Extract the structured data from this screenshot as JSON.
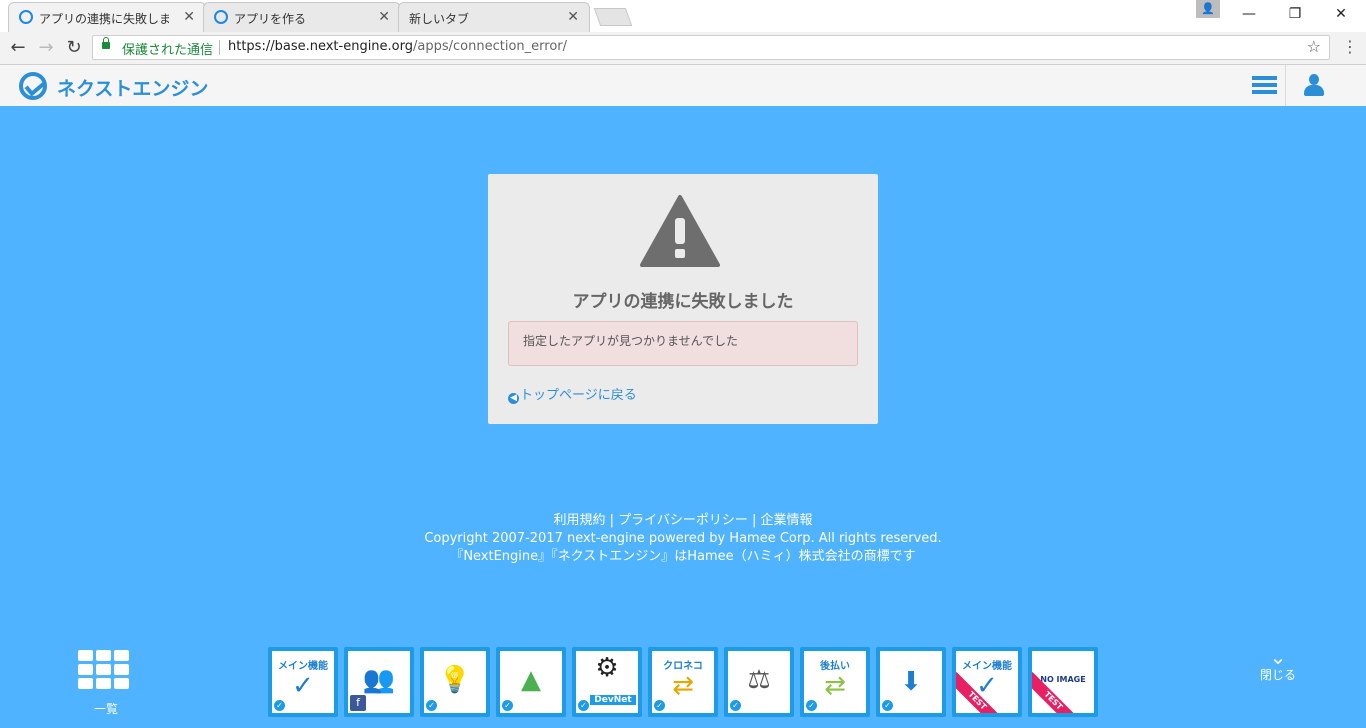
{
  "browser": {
    "tabs": [
      {
        "title": "アプリの連携に失敗しました",
        "active": true
      },
      {
        "title": "アプリを作る",
        "active": false
      },
      {
        "title": "新しいタブ",
        "active": false
      }
    ],
    "secure_label": "保護された通信",
    "url_host": "https://base.next-engine.org",
    "url_path": "/apps/connection_error/"
  },
  "app": {
    "logo_text": "ネクストエンジン"
  },
  "error": {
    "title": "アプリの連携に失敗しました",
    "message": "指定したアプリが見つかりませんでした",
    "back_link": "トップページに戻る"
  },
  "footer": {
    "links": [
      "利用規約",
      "プライバシーポリシー",
      "企業情報"
    ],
    "separator": "|",
    "copyright": "Copyright 2007-2017 next-engine powered by Hamee Corp. All rights reserved.",
    "trademark": "『NextEngine』『ネクストエンジン』はHamee（ハミィ）株式会社の商標です"
  },
  "dock": {
    "grid_label": "一覧",
    "close_label": "閉じる",
    "tiles": [
      {
        "label": "メイン機能",
        "glyph": "✓",
        "ribbon": ""
      },
      {
        "label": "",
        "glyph": "👥",
        "ribbon": ""
      },
      {
        "label": "",
        "glyph": "💡",
        "ribbon": ""
      },
      {
        "label": "",
        "glyph": "▲",
        "ribbon": ""
      },
      {
        "label": "DevNet",
        "glyph": "⚙",
        "ribbon": ""
      },
      {
        "label": "クロネコ",
        "glyph": "⇄",
        "ribbon": ""
      },
      {
        "label": "",
        "glyph": "⚖",
        "ribbon": ""
      },
      {
        "label": "後払い",
        "glyph": "⇄",
        "ribbon": ""
      },
      {
        "label": "",
        "glyph": "⬇",
        "ribbon": ""
      },
      {
        "label": "メイン機能",
        "glyph": "✓",
        "ribbon": "TEST"
      },
      {
        "label": "NO IMAGE",
        "glyph": "",
        "ribbon": "TEST"
      }
    ]
  }
}
